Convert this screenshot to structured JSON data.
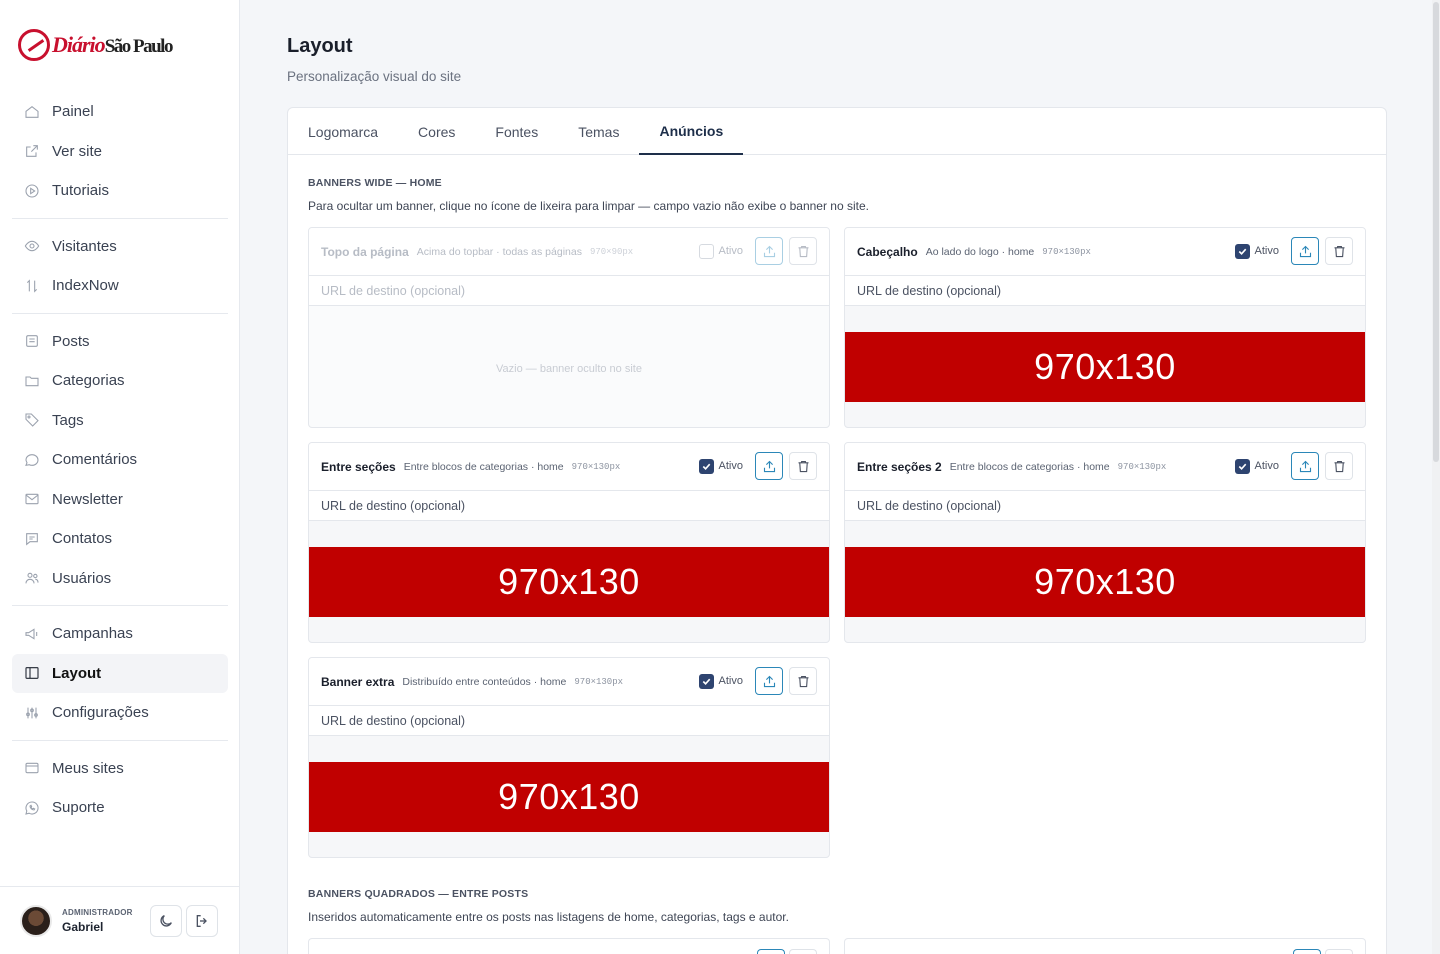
{
  "brand": {
    "logo_prefix": "Diário",
    "logo_rest": "São Paulo",
    "accent": "#c8102e"
  },
  "sidebar": {
    "groups": [
      [
        {
          "label": "Painel",
          "icon": "home-icon"
        },
        {
          "label": "Ver site",
          "icon": "external-link-icon"
        },
        {
          "label": "Tutoriais",
          "icon": "play-circle-icon"
        }
      ],
      [
        {
          "label": "Visitantes",
          "icon": "eye-icon"
        },
        {
          "label": "IndexNow",
          "icon": "arrows-updown-icon"
        }
      ],
      [
        {
          "label": "Posts",
          "icon": "document-icon"
        },
        {
          "label": "Categorias",
          "icon": "folder-icon"
        },
        {
          "label": "Tags",
          "icon": "tag-icon"
        },
        {
          "label": "Comentários",
          "icon": "comment-icon"
        },
        {
          "label": "Newsletter",
          "icon": "mail-icon"
        },
        {
          "label": "Contatos",
          "icon": "chat-icon"
        },
        {
          "label": "Usuários",
          "icon": "users-icon"
        }
      ],
      [
        {
          "label": "Campanhas",
          "icon": "megaphone-icon"
        },
        {
          "label": "Layout",
          "icon": "layout-icon",
          "active": true
        },
        {
          "label": "Configurações",
          "icon": "sliders-icon"
        }
      ],
      [
        {
          "label": "Meus sites",
          "icon": "sites-icon"
        },
        {
          "label": "Suporte",
          "icon": "whatsapp-icon"
        }
      ]
    ],
    "user": {
      "role": "ADMINISTRADOR",
      "name": "Gabriel"
    }
  },
  "header": {
    "title": "Layout",
    "subtitle": "Personalização visual do site"
  },
  "tabs": [
    "Logomarca",
    "Cores",
    "Fontes",
    "Temas",
    "Anúncios"
  ],
  "active_tab": "Anúncios",
  "sections": {
    "wide": {
      "title": "BANNERS WIDE — HOME",
      "desc": "Para ocultar um banner, clique no ícone de lixeira para limpar — campo vazio não exibe o banner no site."
    },
    "square": {
      "title": "BANNERS QUADRADOS — ENTRE POSTS",
      "desc": "Inseridos automaticamente entre os posts nas listagens de home, categorias, tags e autor."
    }
  },
  "slots": [
    {
      "name": "Topo da página",
      "desc": "Acima do topbar · todas as páginas",
      "size": "970×90px",
      "active": false,
      "active_label": "Ativo",
      "url_placeholder": "URL de destino (opcional)",
      "banner": "",
      "empty_msg": "Vazio — banner oculto no site"
    },
    {
      "name": "Cabeçalho",
      "desc": "Ao lado do logo · home",
      "size": "970×130px",
      "active": true,
      "active_label": "Ativo",
      "url_placeholder": "URL de destino (opcional)",
      "banner": "970x130"
    },
    {
      "name": "Entre seções",
      "desc": "Entre blocos de categorias · home",
      "size": "970×130px",
      "active": true,
      "active_label": "Ativo",
      "url_placeholder": "URL de destino (opcional)",
      "banner": "970x130"
    },
    {
      "name": "Entre seções 2",
      "desc": "Entre blocos de categorias · home",
      "size": "970×130px",
      "active": true,
      "active_label": "Ativo",
      "url_placeholder": "URL de destino (opcional)",
      "banner": "970x130"
    },
    {
      "name": "Banner extra",
      "desc": "Distribuído entre conteúdos · home",
      "size": "970×130px",
      "active": true,
      "active_label": "Ativo",
      "url_placeholder": "URL de destino (opcional)",
      "banner": "970x130"
    }
  ],
  "colors": {
    "banner_bg": "#c00000",
    "checkbox": "#2e4470",
    "upload": "#2b87b8"
  }
}
